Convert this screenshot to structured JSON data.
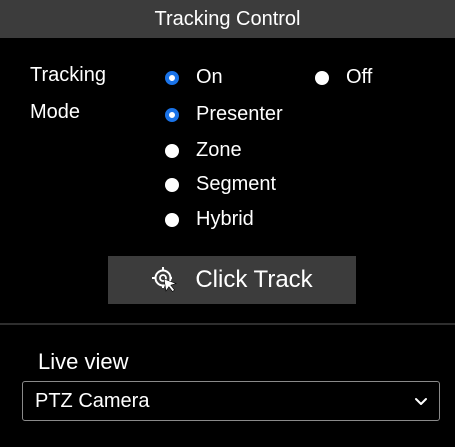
{
  "header": {
    "title": "Tracking Control"
  },
  "tracking": {
    "label": "Tracking",
    "options": [
      {
        "label": "On",
        "selected": true
      },
      {
        "label": "Off",
        "selected": false
      }
    ]
  },
  "mode": {
    "label": "Mode",
    "options": [
      {
        "label": "Presenter",
        "selected": true
      },
      {
        "label": "Zone",
        "selected": false
      },
      {
        "label": "Segment",
        "selected": false
      },
      {
        "label": "Hybrid",
        "selected": false
      }
    ]
  },
  "click_track": {
    "label": "Click Track",
    "icon": "click-track-icon"
  },
  "live_view": {
    "label": "Live view",
    "selected": "PTZ Camera",
    "icon": "chevron-down-icon"
  },
  "colors": {
    "background": "#000000",
    "header": "#3c3c3c",
    "accent": "#1a73e8",
    "text": "#ffffff"
  }
}
